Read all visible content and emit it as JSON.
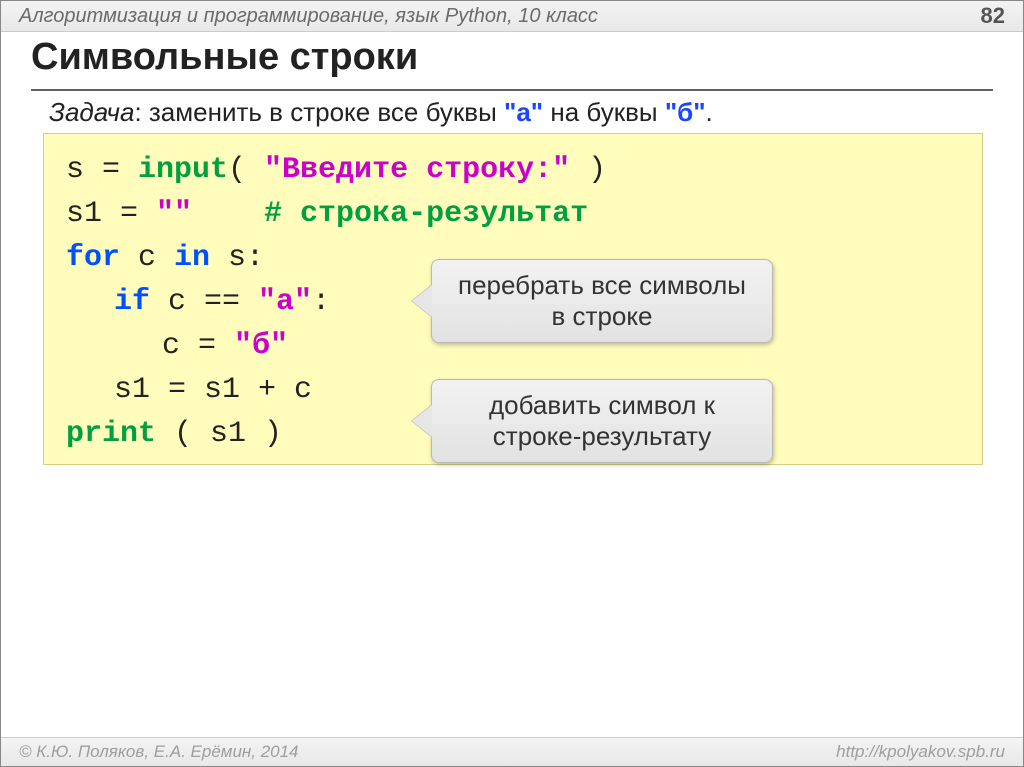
{
  "header": {
    "course": "Алгоритмизация и программирование, язык Python, 10 класс",
    "page": "82"
  },
  "title": "Символьные строки",
  "task": {
    "label": "Задача",
    "colon": ": ",
    "text1": "заменить в строке все буквы ",
    "qa": "\"а\"",
    "text2": " на буквы ",
    "qb": "\"б\"",
    "dot": "."
  },
  "code": {
    "l1": {
      "pre": "s = ",
      "fn": "input",
      "open": "( ",
      "str": "\"Введите строку:\"",
      "close": " )"
    },
    "l2": {
      "pre": "s1 = ",
      "str": "\"\"",
      "sp": "    ",
      "cmt": "# строка-результат"
    },
    "l3": {
      "kw1": "for",
      "mid": " c ",
      "kw2": "in",
      "end": " s:"
    },
    "l4": {
      "kw": "if",
      "mid": " c == ",
      "str": "\"а\"",
      "end": ":"
    },
    "l5": {
      "pre": "c = ",
      "str": "\"б\""
    },
    "l6": {
      "txt": "s1 = s1 + c"
    },
    "l7": {
      "fn": "print",
      "args": " ( s1 )"
    }
  },
  "callouts": {
    "c1": "перебрать все символы в строке",
    "c2": "добавить символ к строке-результату"
  },
  "footer": {
    "copy": "© К.Ю. Поляков, Е.А. Ерёмин, 2014",
    "url": "http://kpolyakov.spb.ru"
  }
}
